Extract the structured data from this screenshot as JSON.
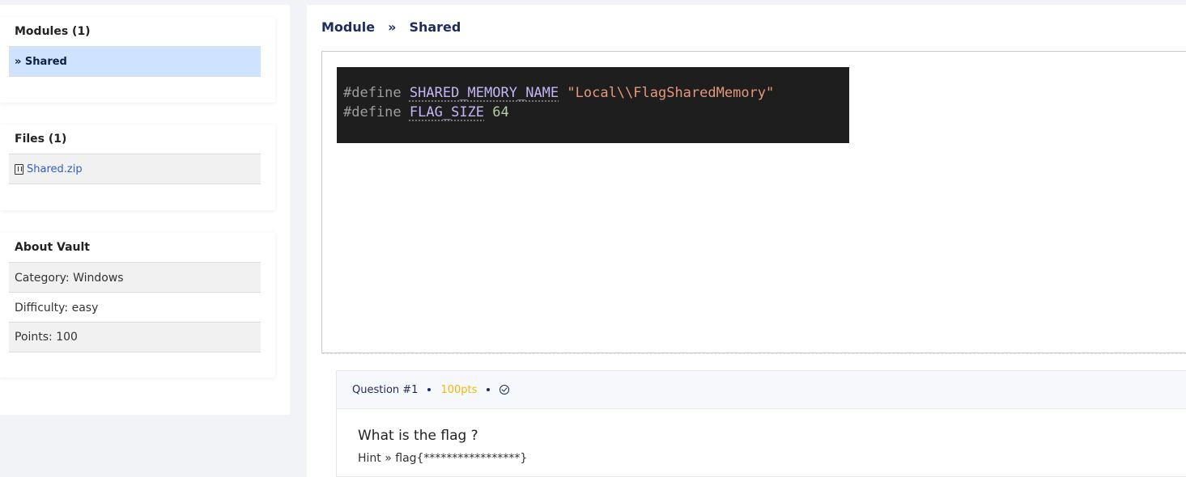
{
  "sidebar": {
    "modules": {
      "title": "Modules (1)",
      "items": [
        {
          "label": "» Shared"
        }
      ]
    },
    "files": {
      "title": "Files (1)",
      "items": [
        {
          "label": "Shared.zip",
          "icon": "file-zip-icon"
        }
      ]
    },
    "about": {
      "title": "About Vault",
      "rows": [
        {
          "label": "Category: Windows"
        },
        {
          "label": "Difficulty: easy"
        },
        {
          "label": "Points: 100"
        }
      ]
    }
  },
  "breadcrumb": {
    "items": [
      "Module",
      "»",
      "Shared"
    ]
  },
  "code": {
    "lines": [
      {
        "keyword": "#define",
        "name": "SHARED_MEMORY_NAME",
        "value": "\"Local\\\\FlagSharedMemory\""
      },
      {
        "keyword": "#define",
        "name": "FLAG_SIZE",
        "value": "64"
      }
    ]
  },
  "question": {
    "label": "Question #1",
    "points": "100pts",
    "status_icon": "check-circle-icon",
    "title": "What is the flag ?",
    "hint": "Hint » flag{*****************}"
  },
  "colors": {
    "active_row": "#cfe2ff",
    "breadcrumb_text": "#1d2c5e",
    "points": "#f0b70a",
    "code_bg": "#1e1e1e"
  }
}
